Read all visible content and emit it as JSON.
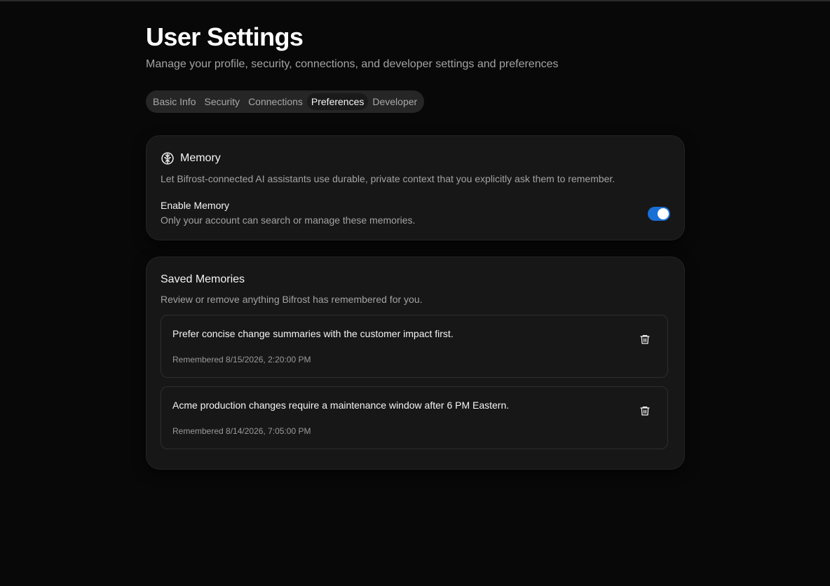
{
  "header": {
    "title": "User Settings",
    "subtitle": "Manage your profile, security, connections, and developer settings and preferences"
  },
  "tabs": [
    {
      "label": "Basic Info",
      "active": false
    },
    {
      "label": "Security",
      "active": false
    },
    {
      "label": "Connections",
      "active": false
    },
    {
      "label": "Preferences",
      "active": true
    },
    {
      "label": "Developer",
      "active": false
    }
  ],
  "memory_card": {
    "icon": "brain-icon",
    "title": "Memory",
    "description": "Let Bifrost-connected AI assistants use durable, private context that you explicitly ask them to remember.",
    "setting_label": "Enable Memory",
    "setting_help": "Only your account can search or manage these memories.",
    "enabled": true,
    "toggle_color": "#1a6fd6"
  },
  "saved_memories": {
    "title": "Saved Memories",
    "description": "Review or remove anything Bifrost has remembered for you.",
    "items": [
      {
        "text": "Prefer concise change summaries with the customer impact first.",
        "date": "Remembered 8/15/2026, 2:20:00 PM",
        "icon": "trash-icon"
      },
      {
        "text": "Acme production changes require a maintenance window after 6 PM Eastern.",
        "date": "Remembered 8/14/2026, 7:05:00 PM",
        "icon": "trash-icon"
      }
    ]
  }
}
